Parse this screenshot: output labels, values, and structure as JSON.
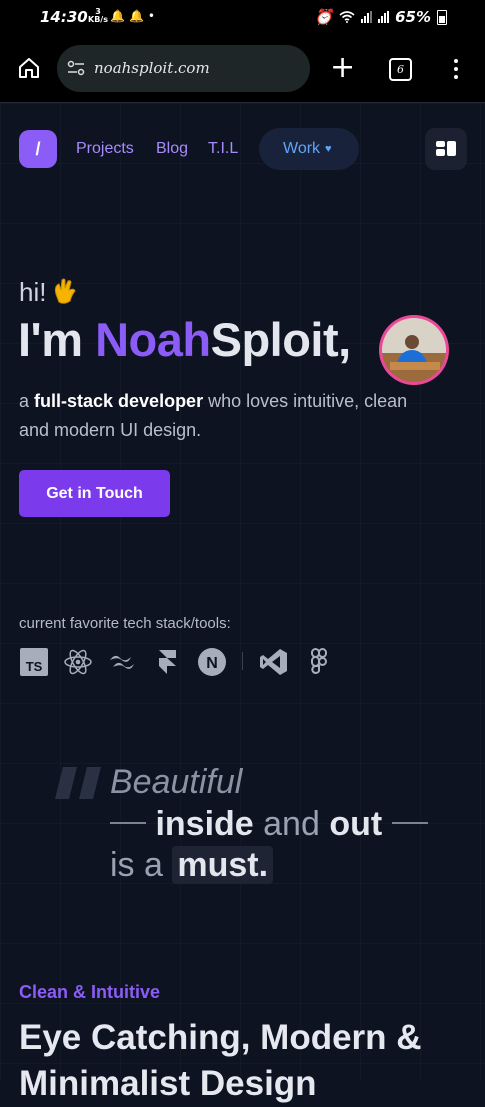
{
  "status_bar": {
    "time": "14:30",
    "data_rate": "3",
    "data_unit": "KB/s",
    "battery": "65%"
  },
  "browser": {
    "url": "noahsploit.com",
    "tab_count": "6"
  },
  "nav": {
    "logo": "/",
    "links": [
      "Projects",
      "Blog",
      "T.I.L"
    ],
    "work_label": "Work"
  },
  "hero": {
    "greeting": "hi!",
    "headline_prefix": "I'm ",
    "name_accent": "Noah",
    "name_rest": "Sploit,",
    "intro_start": "a ",
    "intro_bold": "full-stack developer",
    "intro_end": " who loves intuitive, clean and modern UI design.",
    "cta": "Get in Touch"
  },
  "tech_stack": {
    "label": "current favorite tech stack/tools:",
    "icons": [
      "typescript-icon",
      "react-icon",
      "tailwind-icon",
      "framer-icon",
      "nextjs-icon",
      "vscode-icon",
      "figma-icon"
    ],
    "ts_text": "TS",
    "next_text": "N"
  },
  "quote": {
    "line1": "Beautiful",
    "line2_bold1": "inside",
    "line2_mid": " and ",
    "line2_bold2": "out",
    "line3_pre": "is a ",
    "line3_must": "must."
  },
  "section": {
    "eyebrow": "Clean & Intuitive",
    "title": "Eye Catching, Modern & Minimalist Design"
  },
  "colors": {
    "accent": "#8b5cf6",
    "background": "#0e1322",
    "work_blue": "#60a5fa"
  }
}
